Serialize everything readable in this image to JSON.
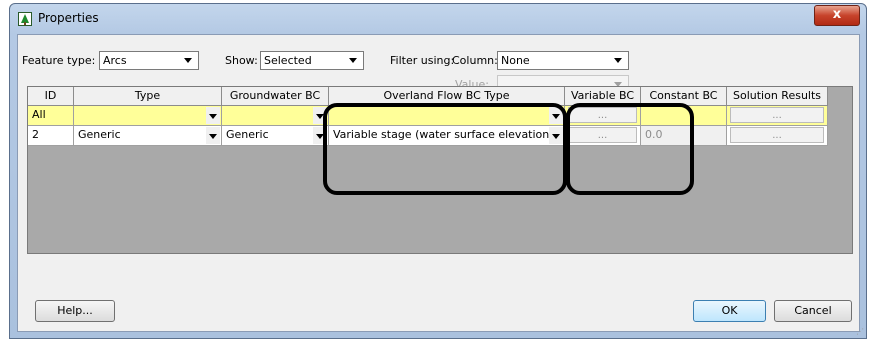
{
  "window": {
    "title": "Properties",
    "close_label": "x"
  },
  "filters": {
    "feature_type_label": "Feature type:",
    "feature_type_value": "Arcs",
    "show_label": "Show:",
    "show_value": "Selected",
    "filter_label": "Filter using:",
    "column_label": "Column:",
    "column_value": "None",
    "value_label": "Value:",
    "value_value": ""
  },
  "table": {
    "headers": [
      "ID",
      "Type",
      "Groundwater BC",
      "Overland Flow BC Type",
      "Variable BC",
      "Constant BC",
      "Solution Results"
    ],
    "rows": [
      {
        "id": "All",
        "type": "",
        "groundwater": "",
        "overland": "",
        "variable": "...",
        "constant": "",
        "solution": "..."
      },
      {
        "id": "2",
        "type": "Generic",
        "groundwater": "Generic",
        "overland": "Variable stage (water surface elevation)",
        "variable": "...",
        "constant": "0.0",
        "solution": "..."
      }
    ]
  },
  "buttons": {
    "help": "Help...",
    "ok": "OK",
    "cancel": "Cancel"
  },
  "icons": {
    "window_icon": "tree-icon",
    "close_icon": "close-icon",
    "dropdown_icon": "chevron-down-icon"
  }
}
